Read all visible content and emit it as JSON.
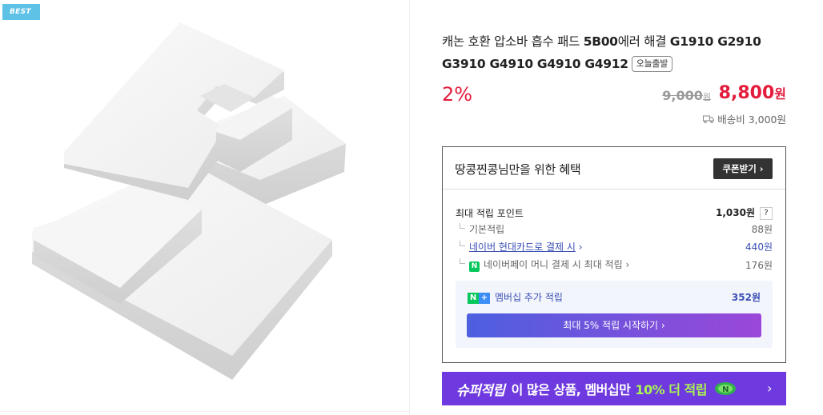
{
  "badge": "BEST",
  "product": {
    "title_prefix": "캐논 호환 압소바 흡수 패드 ",
    "title_bold1": "5B00",
    "title_mid": "에러 해결 ",
    "title_bold2": "G1910 G2910 G3910 G4910 G4910 G4912",
    "today_tag": "오늘출발",
    "discount": "2%",
    "original_price": "9,000",
    "original_unit": "원",
    "sale_price": "8,800",
    "sale_unit": "원",
    "shipping": "배송비 3,000원"
  },
  "benefit": {
    "title": "땅콩찐콩님만을 위한 혜택",
    "coupon_button": "쿠폰받기",
    "rows": [
      {
        "label": "최대 적립 포인트",
        "value": "1,030원",
        "help": "?"
      },
      {
        "label": "기본적립",
        "value": "88원"
      },
      {
        "label": "네이버 현대카드로 결제 시",
        "value": "440원"
      },
      {
        "label": "네이버페이 머니 결제 시 최대 적립",
        "value": "176원",
        "icon": "N"
      }
    ],
    "membership": {
      "label": "멤버십 추가 적립",
      "value": "352원",
      "button": "최대 5% 적립 시작하기"
    }
  },
  "banner": {
    "brand": "슈퍼적립",
    "text": "이 많은 상품, 멤버십만",
    "highlight": "10% 더 적립"
  }
}
